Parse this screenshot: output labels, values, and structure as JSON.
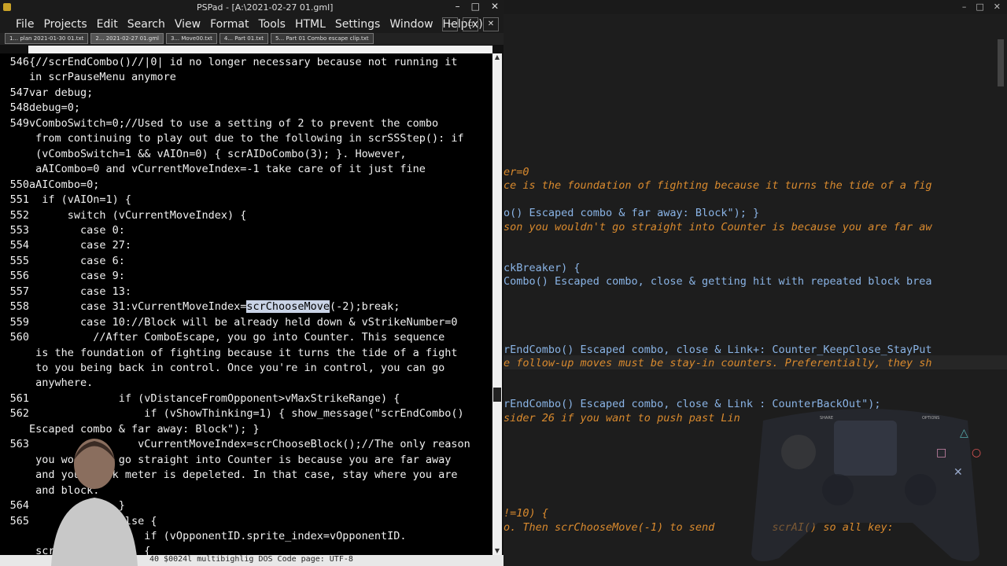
{
  "window": {
    "title": "PSPad - [A:\\2021-02-27 01.gml]"
  },
  "window_controls": {
    "minimize": "–",
    "maximize": "□",
    "close": "✕"
  },
  "menu": [
    "File",
    "Projects",
    "Edit",
    "Search",
    "View",
    "Format",
    "Tools",
    "HTML",
    "Settings",
    "Window",
    "Help(x)"
  ],
  "doc_controls": {
    "minimize": "–",
    "restore": "▫",
    "close": "✕"
  },
  "tabs": [
    "1... plan 2021-01-30 01.txt",
    "2... 2021-02-27 01.gml",
    "3... Move00.txt",
    "4... Part 01.txt",
    "5... Part 01 Combo escape clip.txt"
  ],
  "editor": {
    "lines": [
      {
        "num": "546",
        "text": "{//scrEndCombo()//|0| id no longer necessary because not running it"
      },
      {
        "num": "",
        "text": "in scrPauseMenu anymore"
      },
      {
        "num": "547",
        "text": "var debug;"
      },
      {
        "num": "548",
        "text": "debug=0;"
      },
      {
        "num": "549",
        "text": "vComboSwitch=0;//Used to use a setting of 2 to prevent the combo"
      },
      {
        "num": "",
        "text": " from continuing to play out due to the following in scrSSStep(): if"
      },
      {
        "num": "",
        "text": " (vComboSwitch=1 && vAIOn=0) { scrAIDoCombo(3); }. However,"
      },
      {
        "num": "",
        "text": " aAICombo=0 and vCurrentMoveIndex=-1 take care of it just fine"
      },
      {
        "num": "550",
        "text": "aAICombo=0;"
      },
      {
        "num": "551",
        "text": "  if (vAIOn=1) {"
      },
      {
        "num": "552",
        "text": "      switch (vCurrentMoveIndex) {"
      },
      {
        "num": "553",
        "text": "        case 0:"
      },
      {
        "num": "554",
        "text": "        case 27:"
      },
      {
        "num": "555",
        "text": "        case 6:"
      },
      {
        "num": "556",
        "text": "        case 9:"
      },
      {
        "num": "557",
        "text": "        case 13:"
      },
      {
        "num": "558",
        "text_before": "        case 31:vCurrentMoveIndex=",
        "highlight": "scrChooseMove",
        "text_after": "(-2);break;"
      },
      {
        "num": "559",
        "text": "        case 10://Block will be already held down & vStrikeNumber=0"
      },
      {
        "num": "560",
        "text": "          //After ComboEscape, you go into Counter. This sequence"
      },
      {
        "num": "",
        "text": " is the foundation of fighting because it turns the tide of a fight"
      },
      {
        "num": "",
        "text": " to you being back in control. Once you're in control, you can go"
      },
      {
        "num": "",
        "text": " anywhere."
      },
      {
        "num": "561",
        "text": "              if (vDistanceFromOpponent>vMaxStrikeRange) {"
      },
      {
        "num": "562",
        "text": "                  if (vShowThinking=1) { show_message(\"scrEndCombo()"
      },
      {
        "num": "",
        "text": "Escaped combo & far away: Block\"); }"
      },
      {
        "num": "563",
        "text": "                 vCurrentMoveIndex=scrChooseBlock();//The only reason"
      },
      {
        "num": "",
        "text": " you wouldn't go straight into Counter is because you are far away"
      },
      {
        "num": "",
        "text": " and your rink meter is depeleted. In that case, stay where you are"
      },
      {
        "num": "",
        "text": " and block."
      },
      {
        "num": "564",
        "text": "              }"
      },
      {
        "num": "565",
        "text": "              else {"
      },
      {
        "num": "",
        "text": "                  if (vOpponentID.sprite_index=vOpponentID."
      },
      {
        "num": "",
        "text": " scrBlockBreaker) {"
      }
    ]
  },
  "status_bar": "40  $0024l  multibighlig  DOS  Code page: UTF-8",
  "right_panel": {
    "lines": [
      {
        "text": "er=0",
        "style": "orange"
      },
      {
        "text": "ce is the foundation of fighting because it turns the tide of a fig",
        "style": "orange"
      },
      {
        "text": "o() Escaped combo & far away: Block\"); }",
        "style": "blue"
      },
      {
        "text": "son you wouldn't go straight into Counter is because you are far aw",
        "style": "orange"
      },
      {
        "text": "ckBreaker) {",
        "style": "blue"
      },
      {
        "text": "Combo() Escaped combo, close & getting hit with repeated block brea",
        "style": "blue"
      },
      {
        "text": "rEndCombo() Escaped combo, close & Link+: Counter_KeepClose_StayPut",
        "style": "blue"
      },
      {
        "text": "e follow-up moves must be stay-in counters. Preferentially, they sh",
        "style": "orange"
      },
      {
        "text": "rEndCombo() Escaped combo, close & Link : CounterBackOut\");",
        "style": "blue"
      },
      {
        "text": "sider 26 if you want to push past Lin",
        "style": "orange"
      },
      {
        "text": "!=10) {",
        "style": "orange"
      },
      {
        "text": "o. Then scrChooseMove(-1) to send         scrAI() so all key:",
        "style": "orange"
      }
    ]
  },
  "controller": {
    "share_label": "SHARE",
    "options_label": "OPTIONS"
  },
  "colors": {
    "editor_bg": "#000000",
    "selection": "#c9d3e6",
    "right_blue": "#8ab4e6",
    "right_orange": "#d98a2e"
  }
}
